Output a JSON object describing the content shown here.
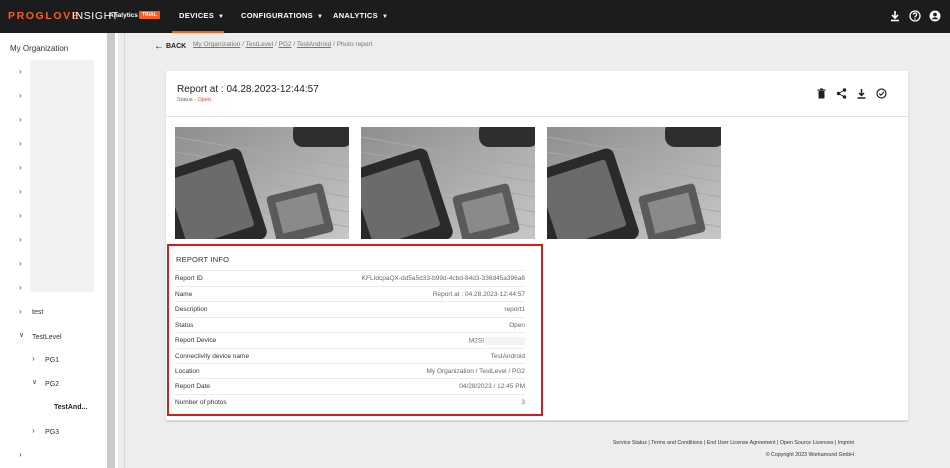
{
  "app": {
    "logo_brand": "PROGLOVE",
    "logo_product": "INSIGHT",
    "logo_analytics": "Analytics",
    "logo_badge": "TRIAL",
    "brand_color": "#ff5c1a"
  },
  "nav": {
    "items": [
      {
        "label": "DEVICES",
        "active": true
      },
      {
        "label": "CONFIGURATIONS",
        "active": false
      },
      {
        "label": "ANALYTICS",
        "active": false
      }
    ],
    "icons": [
      "download-icon",
      "help-icon",
      "account-icon"
    ]
  },
  "sidebar": {
    "title": "My Organization",
    "tree": [
      {
        "label": "test",
        "expanded": false
      },
      {
        "label": "TestLevel",
        "expanded": true
      },
      {
        "label": "PG1",
        "expanded": false
      },
      {
        "label": "PG2",
        "expanded": true
      },
      {
        "label": "TestAnd...",
        "selected": true
      },
      {
        "label": "PG3",
        "expanded": false
      }
    ]
  },
  "breadcrumb": {
    "back_label": "BACK",
    "items": [
      "My Organization",
      "TestLevel",
      "PG2",
      "TestAndroid"
    ],
    "current": "Photo report"
  },
  "report": {
    "title": "Report at : 04.28.2023-12:44:57",
    "status_prefix": "Status -",
    "status_value": "Open",
    "status_color": "#e44444",
    "actions": [
      "delete-icon",
      "share-icon",
      "download-icon",
      "resolve-icon"
    ],
    "photo_count_shown": 3
  },
  "report_info": {
    "title": "REPORT INFO",
    "rows": [
      {
        "key": "Report ID",
        "value": "KFLIdcpaQX-dd5a5d33-b99d-4cbd-84d3-336d45a396a6"
      },
      {
        "key": "Name",
        "value": "Report at : 04.28.2023-12:44:57"
      },
      {
        "key": "Description",
        "value": "report1"
      },
      {
        "key": "Status",
        "value": "Open"
      },
      {
        "key": "Report Device",
        "value": "M2SI"
      },
      {
        "key": "Connectivity device name",
        "value": "TestAndroid"
      },
      {
        "key": "Location",
        "value": "My Organization / TestLevel / PG2"
      },
      {
        "key": "Report Date",
        "value": "04/28/2023 / 12:45 PM"
      },
      {
        "key": "Number of photos",
        "value": "3"
      }
    ]
  },
  "footer": {
    "links": "Service Status | Terms and Conditions | End User License Agreement | Open Source Licenses | Imprint",
    "copyright": "© Copyright 2023 Workaround GmbH"
  }
}
